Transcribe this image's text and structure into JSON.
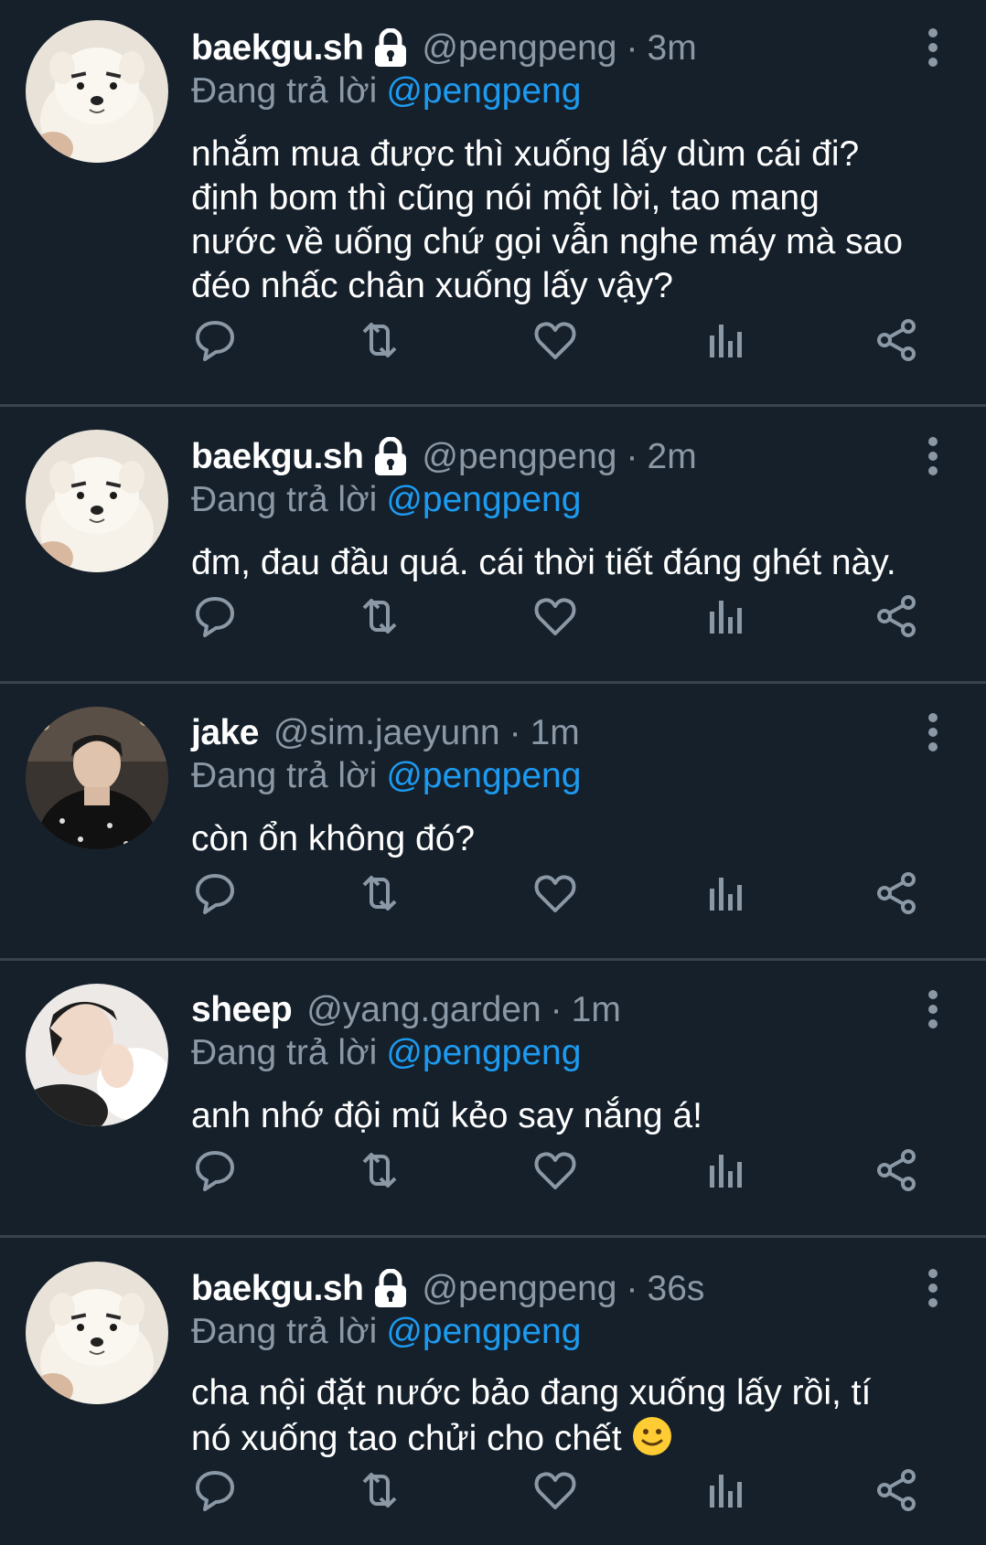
{
  "tweets": [
    {
      "name": "baekgu.sh",
      "protected": true,
      "handle": "@pengpeng",
      "separator": "·",
      "time": "3m",
      "reply_prefix": "Đang trả lời",
      "reply_to": "@pengpeng",
      "lines": [
        "nhắm mua được thì xuống lấy dùm cái đi?",
        "định bom thì cũng nói một lời, tao mang",
        "nước về uống chứ gọi vẫn nghe máy mà sao",
        "đéo nhấc chân xuống lấy vậy?"
      ],
      "avatar": "dog"
    },
    {
      "name": "baekgu.sh",
      "protected": true,
      "handle": "@pengpeng",
      "separator": "·",
      "time": "2m",
      "reply_prefix": "Đang trả lời",
      "reply_to": "@pengpeng",
      "lines": [
        "đm, đau đầu quá. cái thời tiết đáng ghét này."
      ],
      "avatar": "dog"
    },
    {
      "name": "jake",
      "protected": false,
      "handle": "@sim.jaeyunn",
      "separator": "·",
      "time": "1m",
      "reply_prefix": "Đang trả lời",
      "reply_to": "@pengpeng",
      "lines": [
        "còn ổn không đó?"
      ],
      "avatar": "person-dark"
    },
    {
      "name": "sheep",
      "protected": false,
      "handle": "@yang.garden",
      "separator": "·",
      "time": "1m",
      "reply_prefix": "Đang trả lời",
      "reply_to": "@pengpeng",
      "lines": [
        "anh nhớ đội mũ kẻo say nắng á!"
      ],
      "avatar": "person-light"
    },
    {
      "name": "baekgu.sh",
      "protected": true,
      "handle": "@pengpeng",
      "separator": "·",
      "time": "36s",
      "reply_prefix": "Đang trả lời",
      "reply_to": "@pengpeng",
      "lines": [
        "cha nội đặt nước bảo đang xuống lấy rồi, tí",
        "nó xuống tao chửi cho chết"
      ],
      "last_line_emoji": "slightly-smiling-face",
      "avatar": "dog"
    }
  ],
  "icons": {
    "reply": "reply-icon",
    "retweet": "retweet-icon",
    "like": "heart-icon",
    "views": "views-icon",
    "share": "share-icon",
    "more": "more-vertical-icon",
    "lock": "lock-icon"
  },
  "colors": {
    "background": "#15202b",
    "divider": "#38444d",
    "text": "#ffffff",
    "muted": "#8b98a5",
    "accent": "#1d9bf0"
  }
}
